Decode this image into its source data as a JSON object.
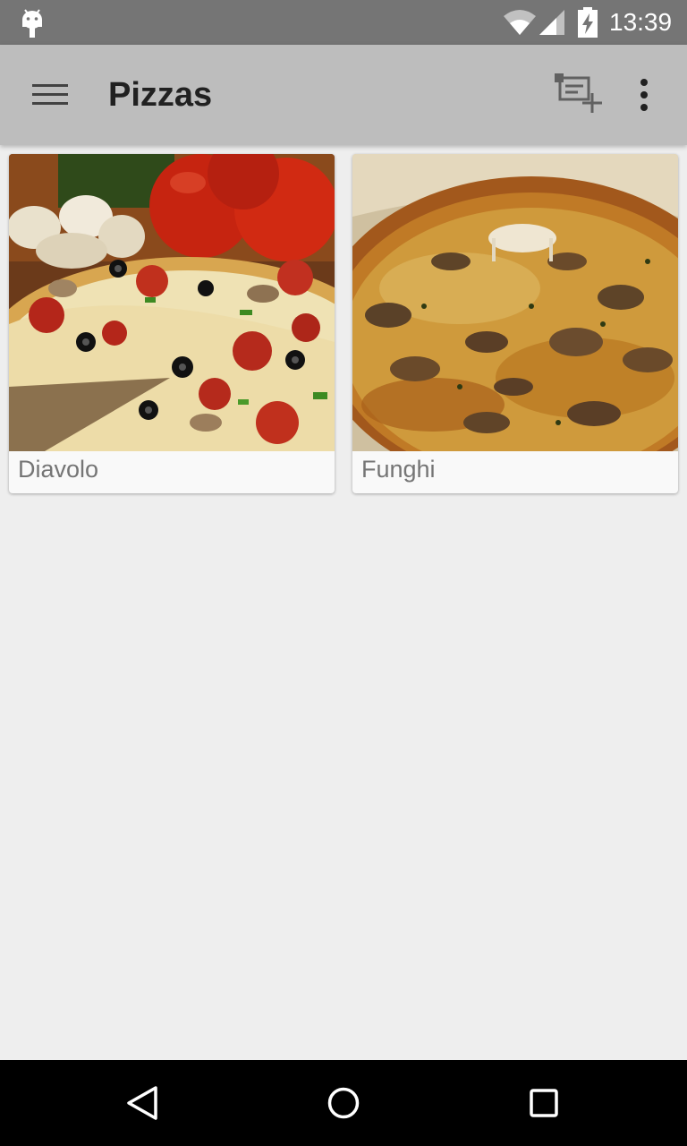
{
  "status_bar": {
    "time": "13:39",
    "icons": [
      "android-icon",
      "wifi-icon",
      "cell-signal-icon",
      "battery-charging-icon"
    ]
  },
  "app_bar": {
    "title": "Pizzas",
    "icons": [
      "menu-icon",
      "add-to-queue-icon",
      "more-vert-icon"
    ]
  },
  "pizzas": [
    {
      "name": "Diavolo"
    },
    {
      "name": "Funghi"
    }
  ],
  "nav_bar": {
    "icons": [
      "back-icon",
      "home-icon",
      "recents-icon"
    ]
  },
  "colors": {
    "status_bar": "#757575",
    "app_bar": "#bdbdbd",
    "background": "#eeeeee",
    "card": "#f9f9f9",
    "nav_bar": "#000000"
  }
}
